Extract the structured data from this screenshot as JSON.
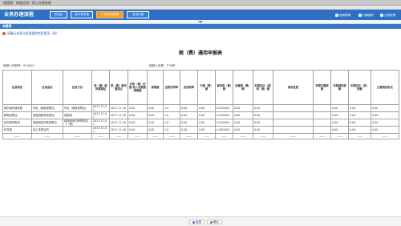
{
  "window": {
    "title": "增值税 - 网络应用 - 网上办税系统"
  },
  "header": {
    "brand": "业务办理流程",
    "steps": [
      "初始化",
      "填写表申报",
      "3. 填写申报表",
      "发送申报"
    ],
    "links": [
      "使用帮助",
      "切换模块",
      "文档说明"
    ]
  },
  "panel": {
    "title": "申报表"
  },
  "notice": "请确认本表与您填报的信息是否一致？",
  "document": {
    "title": "税（费）通用申报表",
    "taxpayer_id_label": "纳税人识别号：914401",
    "taxpayer_name_label": "纳税人名称：广州市"
  },
  "table": {
    "headers": [
      "征收项目",
      "征收品目",
      "征收子目",
      "税（费）款所属期起",
      "税（费）款所属期止",
      "计税（费）依据 收入总额或销售额",
      "减除额",
      "应税所得率",
      "适用税率",
      "已缴（费）额",
      "减免税（费）额",
      "应缴税（费）额",
      "本期应补（退）税（费）额",
      "减免性质",
      "本期已缴税额",
      "本期减免税额",
      "本期应补（退）税额",
      "主管税务机关"
    ],
    "rows": [
      [
        "城市维护建设税",
        "市区（增值税附征）",
        "市区（增值税附征）",
        "2017-11-01",
        "2017-11-30",
        "0.00",
        "0.00",
        "1.0",
        "0.00",
        "0.00",
        "0.070000",
        "0.00",
        "0.00",
        "",
        "",
        "0.00",
        "0.00",
        "0.00"
      ],
      [
        "教育费附加",
        "增值税教育费附加",
        "增值税",
        "2017-11-01",
        "2017-11-30",
        "0.00",
        "0.00",
        "1.0",
        "0.00",
        "0.00",
        "0.030000",
        "0.00",
        "0.00",
        "",
        "",
        "0.00",
        "0.00",
        "0.00"
      ],
      [
        "地方教育附加",
        "增值税地方教育附加",
        "增值税地方教育附加（一般）",
        "2017-11-01",
        "2017-11-30",
        "0.00",
        "0.00",
        "1.0",
        "0.00",
        "0.00",
        "0.020000",
        "0.00",
        "0.00",
        "",
        "",
        "0.00",
        "0.00",
        "0.00"
      ],
      [
        "印花税",
        "加工承揽合同",
        "",
        "2017-11-01",
        "2017-11-30",
        "0.00",
        "0.00",
        "1.0",
        "0.00",
        "0.00",
        "0.000500",
        "0.00",
        "0.00",
        "",
        "",
        "0.00",
        "0.00",
        "0.00"
      ],
      [
        "——",
        "——",
        "——",
        "——",
        "——",
        "——",
        "——",
        "——",
        "——",
        "——",
        "——",
        "——",
        "——",
        "——",
        "——",
        "——",
        "——",
        "——"
      ]
    ]
  },
  "footer": {
    "back_label": "返回",
    "confirm_label": "确认"
  }
}
